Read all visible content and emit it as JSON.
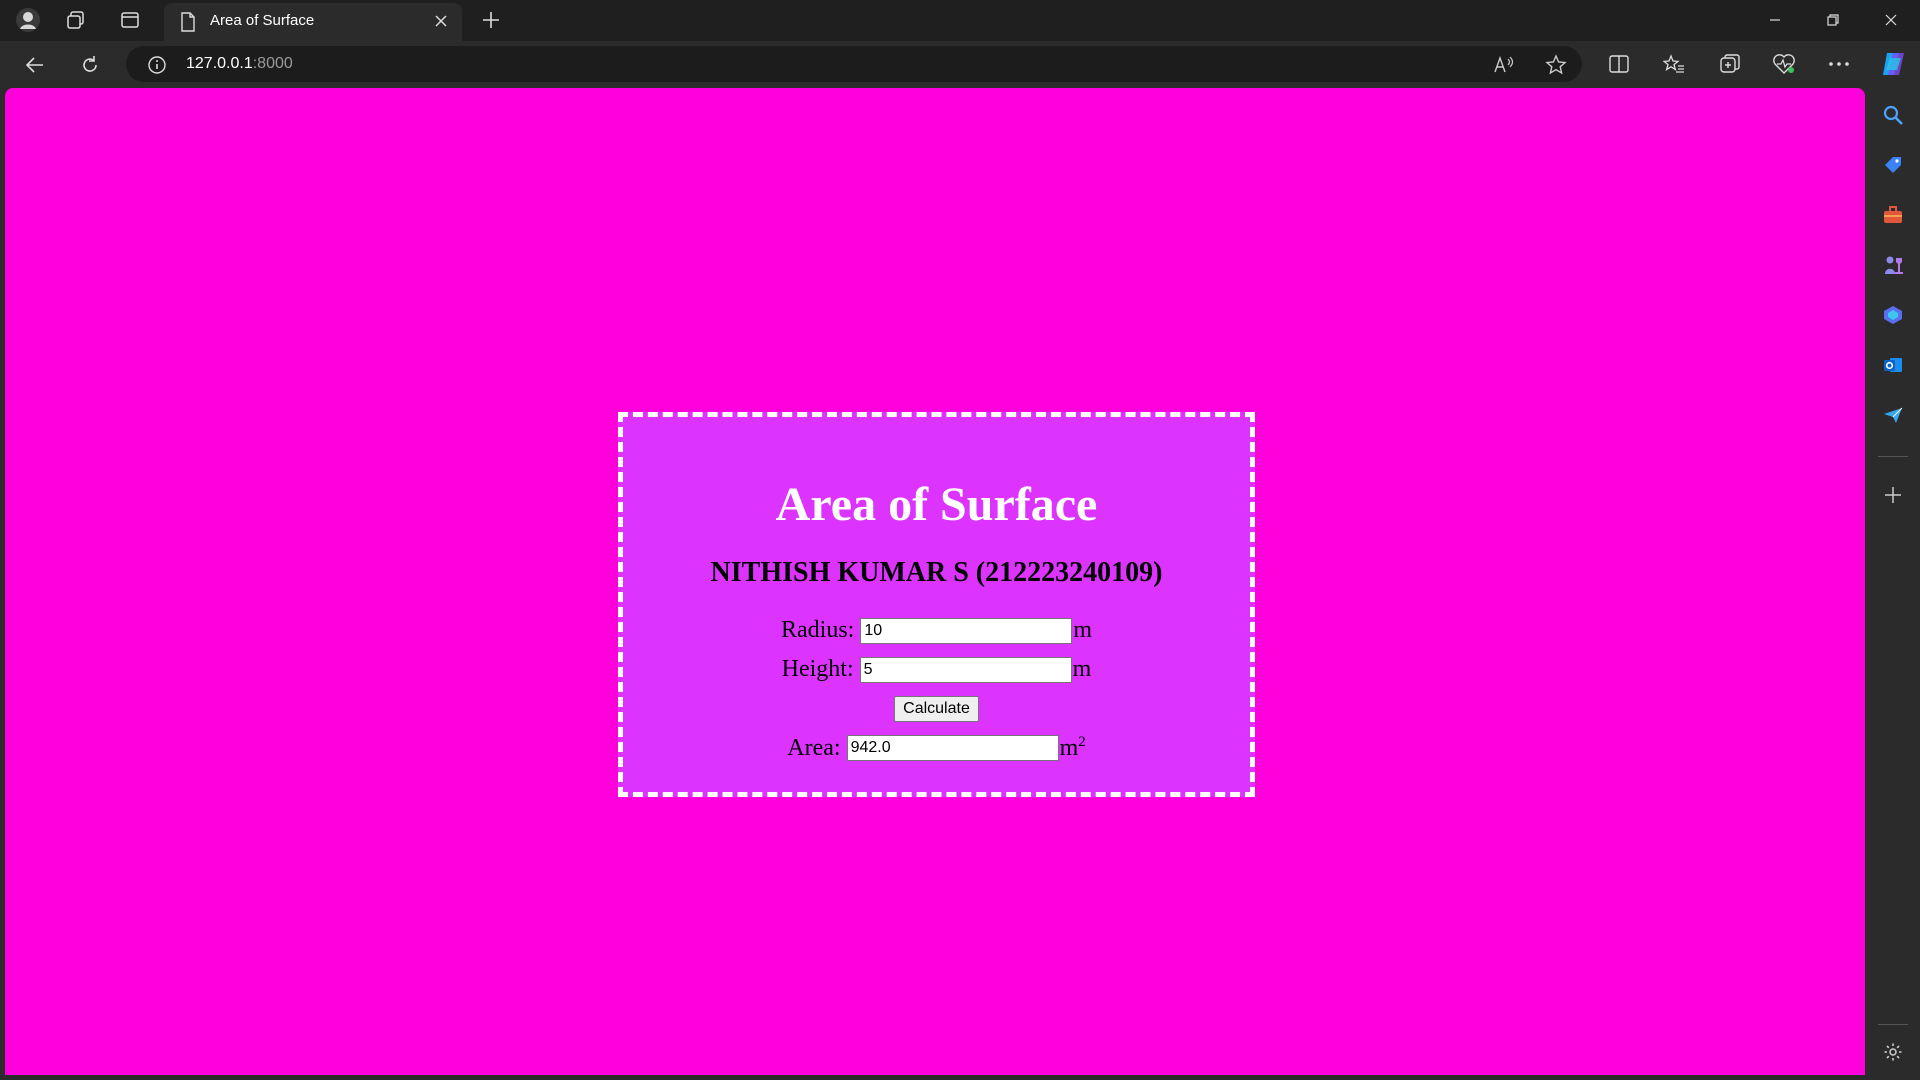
{
  "browser": {
    "tab": {
      "title": "Area of Surface"
    },
    "address": {
      "host": "127.0.0.1",
      "port": ":8000"
    }
  },
  "page": {
    "title": "Area of Surface",
    "author": "NITHISH KUMAR S (212223240109)",
    "radius": {
      "label": "Radius:",
      "value": "10",
      "unit": "m"
    },
    "height": {
      "label": "Height:",
      "value": "5",
      "unit": "m"
    },
    "calculate_label": "Calculate",
    "area": {
      "label": "Area:",
      "value": "942.0",
      "unit": "m",
      "exponent": "2"
    }
  },
  "colors": {
    "page_background": "#ff00dd",
    "card_background": "#dd33ff",
    "card_border": "#ffffff"
  }
}
